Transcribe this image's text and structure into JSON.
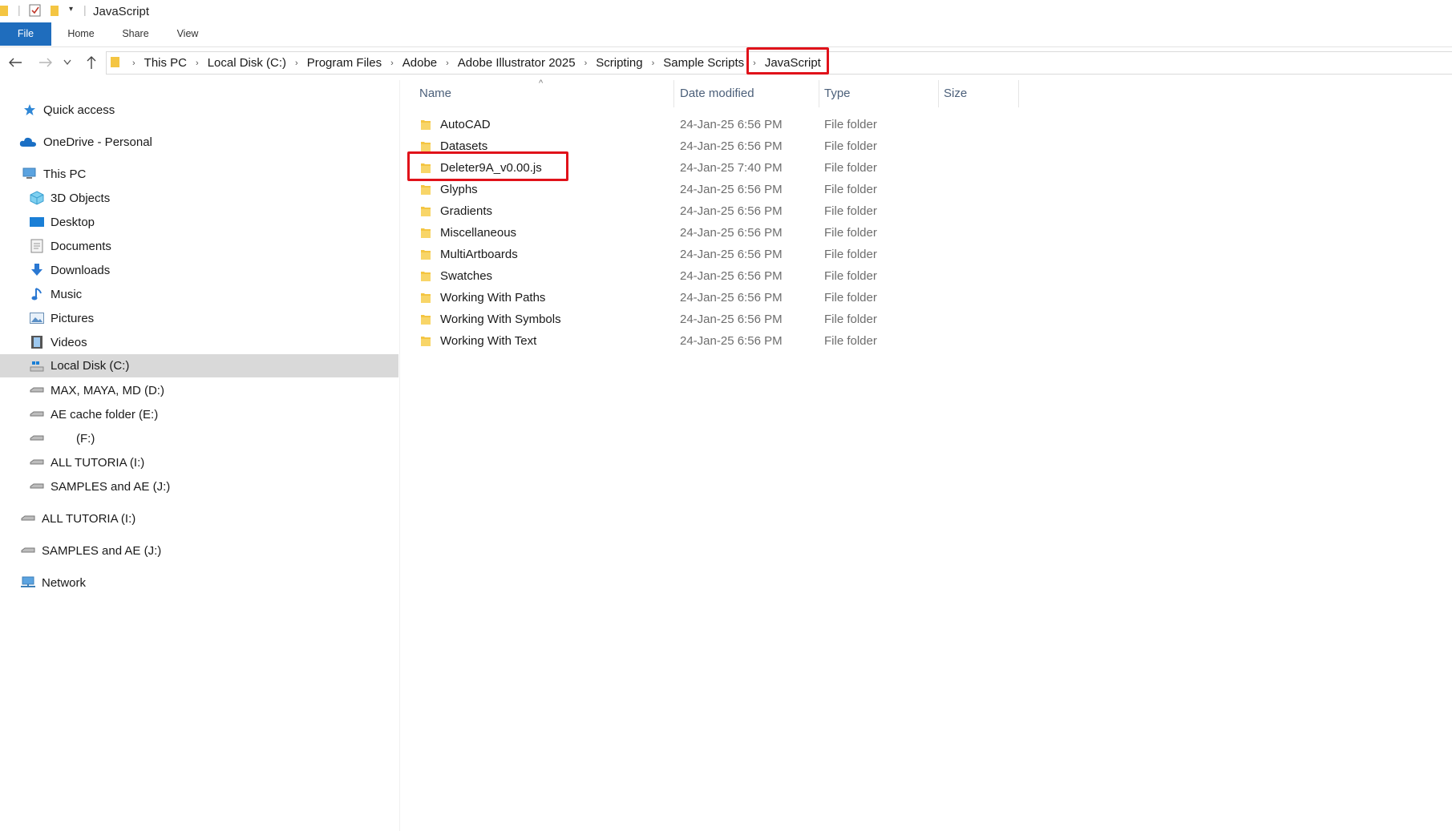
{
  "window": {
    "title": "JavaScript"
  },
  "ribbon": {
    "tabs": [
      "File",
      "Home",
      "Share",
      "View"
    ]
  },
  "address": {
    "crumbs": [
      "This PC",
      "Local Disk (C:)",
      "Program Files",
      "Adobe",
      "Adobe Illustrator 2025",
      "Scripting",
      "Sample Scripts",
      "JavaScript"
    ]
  },
  "nav": {
    "quick_access": "Quick access",
    "onedrive": "OneDrive - Personal",
    "this_pc": "This PC",
    "objects3d": "3D Objects",
    "desktop": "Desktop",
    "documents": "Documents",
    "downloads": "Downloads",
    "music": "Music",
    "pictures": "Pictures",
    "videos": "Videos",
    "drive_c": "Local Disk (C:)",
    "drive_d": "MAX, MAYA, MD (D:)",
    "drive_e": "AE cache folder (E:)",
    "drive_f": "(F:)",
    "drive_i": "ALL TUTORIA (I:)",
    "drive_j": "SAMPLES and AE (J:)",
    "drive_i_top": "ALL TUTORIA (I:)",
    "drive_j_top": "SAMPLES and AE (J:)",
    "network": "Network"
  },
  "columns": {
    "name": "Name",
    "date": "Date modified",
    "type": "Type",
    "size": "Size"
  },
  "files": [
    {
      "name": "AutoCAD",
      "date": "24-Jan-25 6:56 PM",
      "type": "File folder"
    },
    {
      "name": "Datasets",
      "date": "24-Jan-25 6:56 PM",
      "type": "File folder"
    },
    {
      "name": "Deleter9A_v0.00.js",
      "date": "24-Jan-25 7:40 PM",
      "type": "File folder"
    },
    {
      "name": "Glyphs",
      "date": "24-Jan-25 6:56 PM",
      "type": "File folder"
    },
    {
      "name": "Gradients",
      "date": "24-Jan-25 6:56 PM",
      "type": "File folder"
    },
    {
      "name": "Miscellaneous",
      "date": "24-Jan-25 6:56 PM",
      "type": "File folder"
    },
    {
      "name": "MultiArtboards",
      "date": "24-Jan-25 6:56 PM",
      "type": "File folder"
    },
    {
      "name": "Swatches",
      "date": "24-Jan-25 6:56 PM",
      "type": "File folder"
    },
    {
      "name": "Working With Paths",
      "date": "24-Jan-25 6:56 PM",
      "type": "File folder"
    },
    {
      "name": "Working With Symbols",
      "date": "24-Jan-25 6:56 PM",
      "type": "File folder"
    },
    {
      "name": "Working With Text",
      "date": "24-Jan-25 6:56 PM",
      "type": "File folder"
    }
  ],
  "colors": {
    "accent": "#1f6dbd",
    "highlight": "#e0121a",
    "folder": "#f4c542",
    "selected_bg": "#d9d9d9"
  }
}
